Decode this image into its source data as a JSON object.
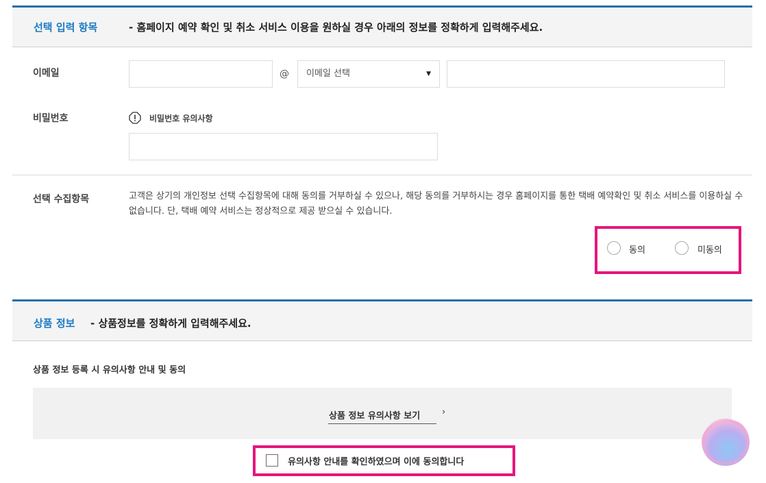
{
  "section1": {
    "title": "선택 입력 항목",
    "desc": "- 홈페이지 예약 확인 및 취소 서비스 이용을 원하실 경우 아래의 정보를 정확하게 입력해주세요.",
    "email": {
      "label": "이메일",
      "at": "@",
      "domain_select": "이메일 선택",
      "local_value": "",
      "domain_value": ""
    },
    "password": {
      "label": "비밀번호",
      "notice": "비밀번호 유의사항",
      "value": ""
    },
    "consent": {
      "label": "선택 수집항목",
      "text": "고객은 상기의 개인정보 선택 수집항목에 대해 동의를 거부하실 수 있으나, 해당 동의를 거부하시는 경우 홈페이지를 통한 택배 예약확인 및 취소 서비스를 이용하실 수 없습니다. 단, 택배 예약 서비스는 정상적으로 제공 받으실 수 있습니다.",
      "agree": "동의",
      "disagree": "미동의"
    }
  },
  "section2": {
    "title": "상품 정보",
    "desc": "- 상품정보를 정확하게 입력해주세요.",
    "subtitle": "상품 정보 등록 시 유의사항 안내 및 동의",
    "view_link": "상품 정보 유의사항 보기",
    "view_arrow": "›",
    "checkbox_label": "유의사항 안내를 확인하였으며 이에 동의합니다"
  },
  "colors": {
    "accent_blue": "#1a7ac4",
    "highlight_pink": "#e5167c"
  }
}
